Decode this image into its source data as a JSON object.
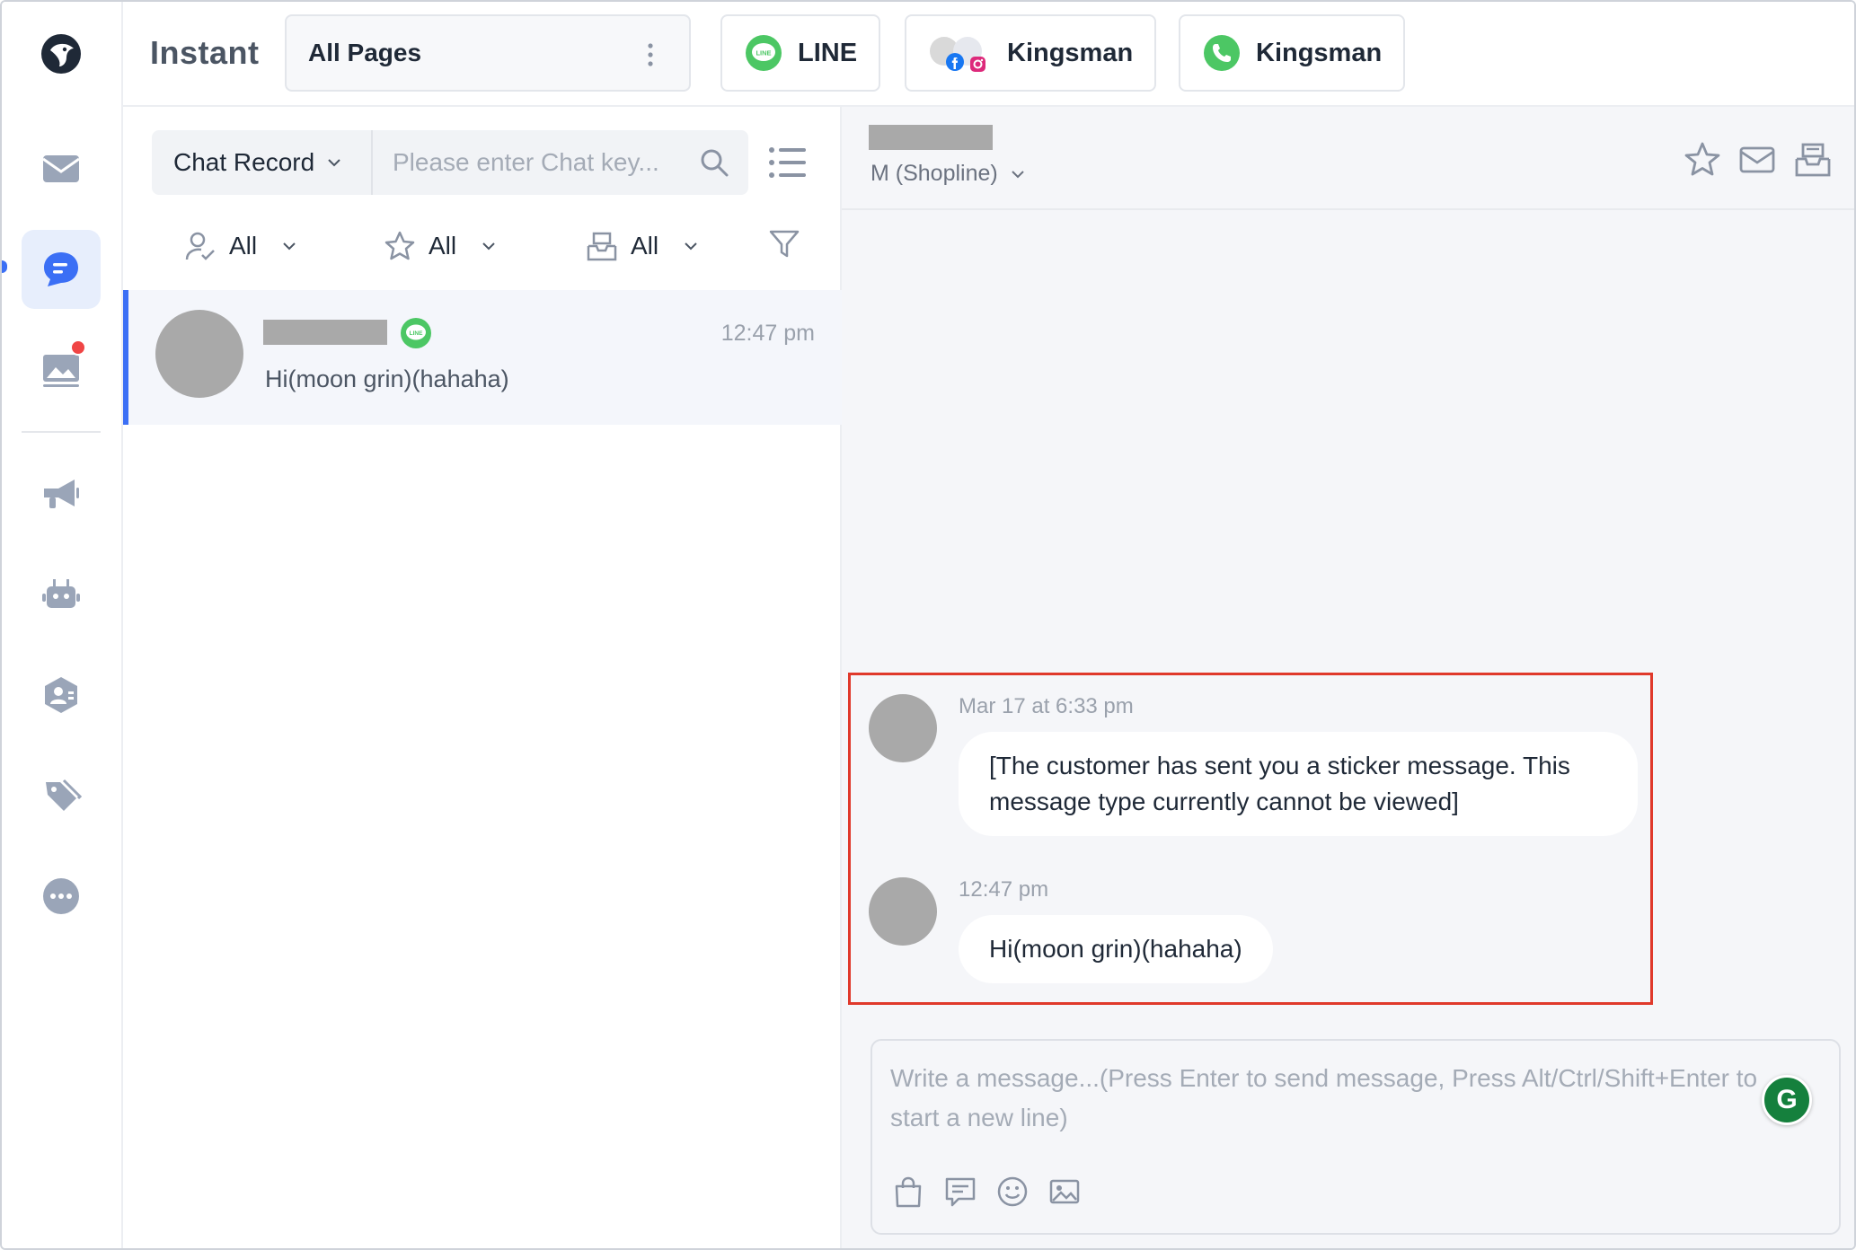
{
  "app": {
    "title": "Instant"
  },
  "topbar": {
    "pages_select": "All Pages",
    "channels": [
      {
        "label": "LINE",
        "icon": "line-icon"
      },
      {
        "label": "Kingsman",
        "icon": "facebook-instagram-icon"
      },
      {
        "label": "Kingsman",
        "icon": "whatsapp-icon"
      }
    ]
  },
  "rail": {
    "items": [
      "mail-icon",
      "chat-icon",
      "posts-icon",
      "broadcast-icon",
      "bot-icon",
      "contacts-icon",
      "tags-icon",
      "more-icon"
    ],
    "active": "chat-icon"
  },
  "list": {
    "record_select": "Chat Record",
    "search_placeholder": "Please enter Chat key...",
    "filters": [
      {
        "icon": "assignee-icon",
        "label": "All"
      },
      {
        "icon": "star-icon",
        "label": "All"
      },
      {
        "icon": "inbox-icon",
        "label": "All"
      }
    ],
    "conversations": [
      {
        "channel": "LINE",
        "time": "12:47 pm",
        "preview": "Hi(moon grin)(hahaha)"
      }
    ]
  },
  "chat": {
    "store": "M (Shopline)",
    "messages": [
      {
        "time": "Mar 17 at 6:33 pm",
        "text": "[The customer has sent you a sticker message. This message type currently cannot be viewed]"
      },
      {
        "time": "12:47 pm",
        "text": "Hi(moon grin)(hahaha)"
      }
    ],
    "composer_placeholder": "Write a message...(Press Enter to send message, Press Alt/Ctrl/Shift+Enter to start a new line)",
    "grammarly_letter": "G"
  },
  "colors": {
    "accent": "#3b6ff5",
    "line_green": "#4cc764",
    "highlight_red": "#e0392b",
    "icon_gray": "#9aa5b8"
  }
}
